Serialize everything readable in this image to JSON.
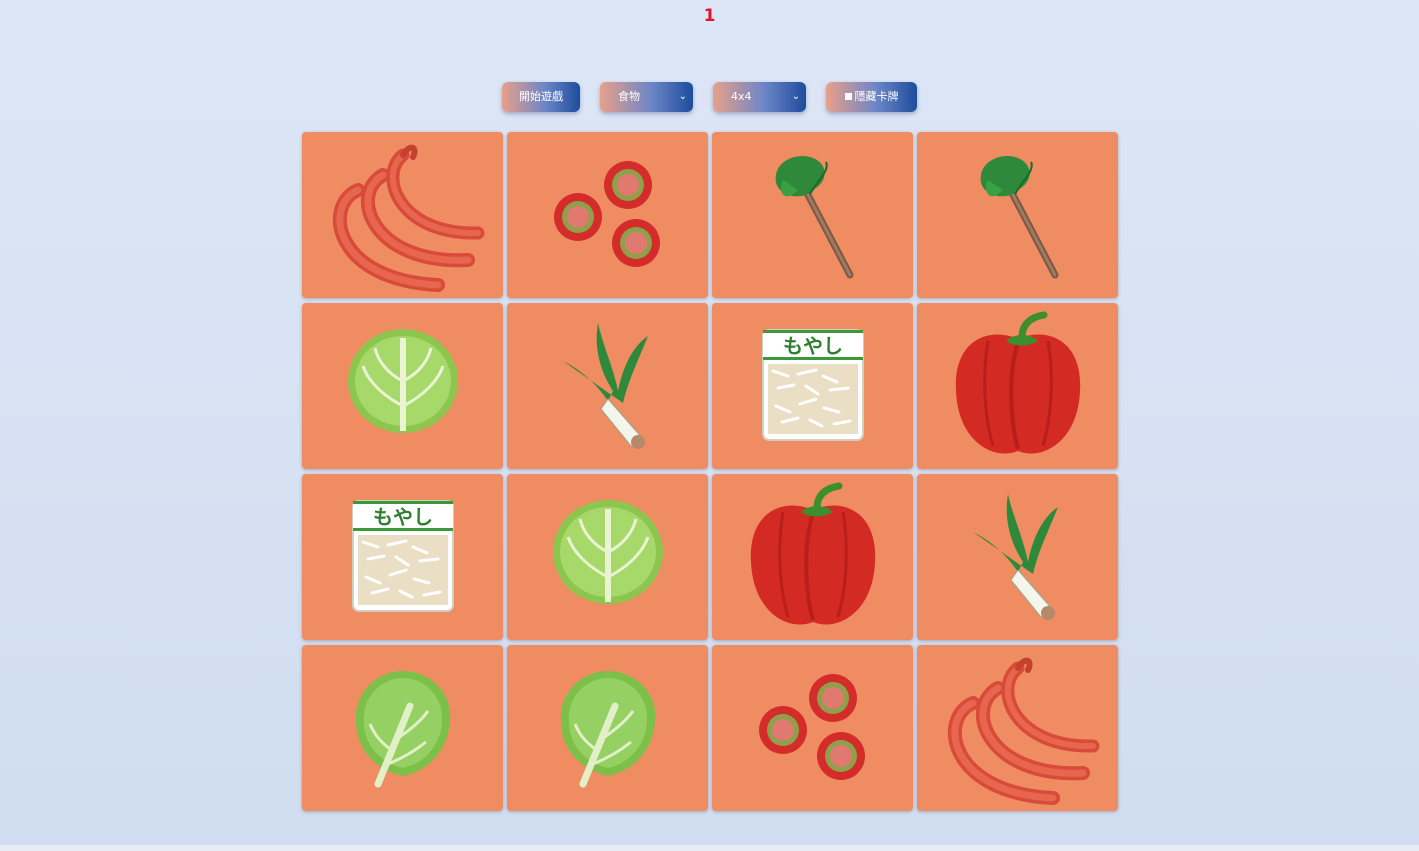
{
  "score": "1",
  "controls": {
    "start_label": "開始遊戲",
    "category_value": "食物",
    "size_value": "4x4",
    "hide_label": "隱藏卡牌"
  },
  "board": {
    "card_color": "#f08c62",
    "cards": [
      {
        "icon": "red-peppers-icon"
      },
      {
        "icon": "cherry-tomatoes-icon"
      },
      {
        "icon": "burdock-root-icon"
      },
      {
        "icon": "burdock-root-icon"
      },
      {
        "icon": "cabbage-icon"
      },
      {
        "icon": "leek-icon"
      },
      {
        "icon": "bean-sprouts-icon",
        "text": "もやし"
      },
      {
        "icon": "bell-pepper-icon"
      },
      {
        "icon": "bean-sprouts-icon",
        "text": "もやし"
      },
      {
        "icon": "cabbage-icon"
      },
      {
        "icon": "bell-pepper-icon"
      },
      {
        "icon": "leek-icon"
      },
      {
        "icon": "lettuce-icon"
      },
      {
        "icon": "lettuce-icon"
      },
      {
        "icon": "cherry-tomatoes-icon"
      },
      {
        "icon": "red-peppers-icon"
      }
    ]
  }
}
